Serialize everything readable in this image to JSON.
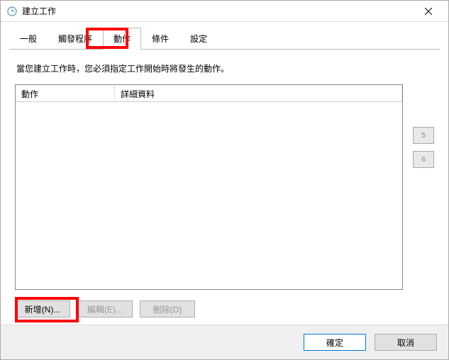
{
  "title": "建立工作",
  "tabs": [
    {
      "id": "general",
      "label": "一般"
    },
    {
      "id": "triggers",
      "label": "觸發程序"
    },
    {
      "id": "actions",
      "label": "動作"
    },
    {
      "id": "conditions",
      "label": "條件"
    },
    {
      "id": "settings",
      "label": "設定"
    }
  ],
  "active_tab": "actions",
  "description": "當您建立工作時，您必須指定工作開始時將發生的動作。",
  "table": {
    "columns": [
      "動作",
      "詳細資料"
    ],
    "rows": []
  },
  "side_buttons": {
    "up": "5",
    "down": "6"
  },
  "action_buttons": {
    "new": "新增(N)...",
    "edit": "編輯(E)...",
    "delete": "刪除(D)"
  },
  "footer": {
    "ok": "確定",
    "cancel": "取消"
  }
}
